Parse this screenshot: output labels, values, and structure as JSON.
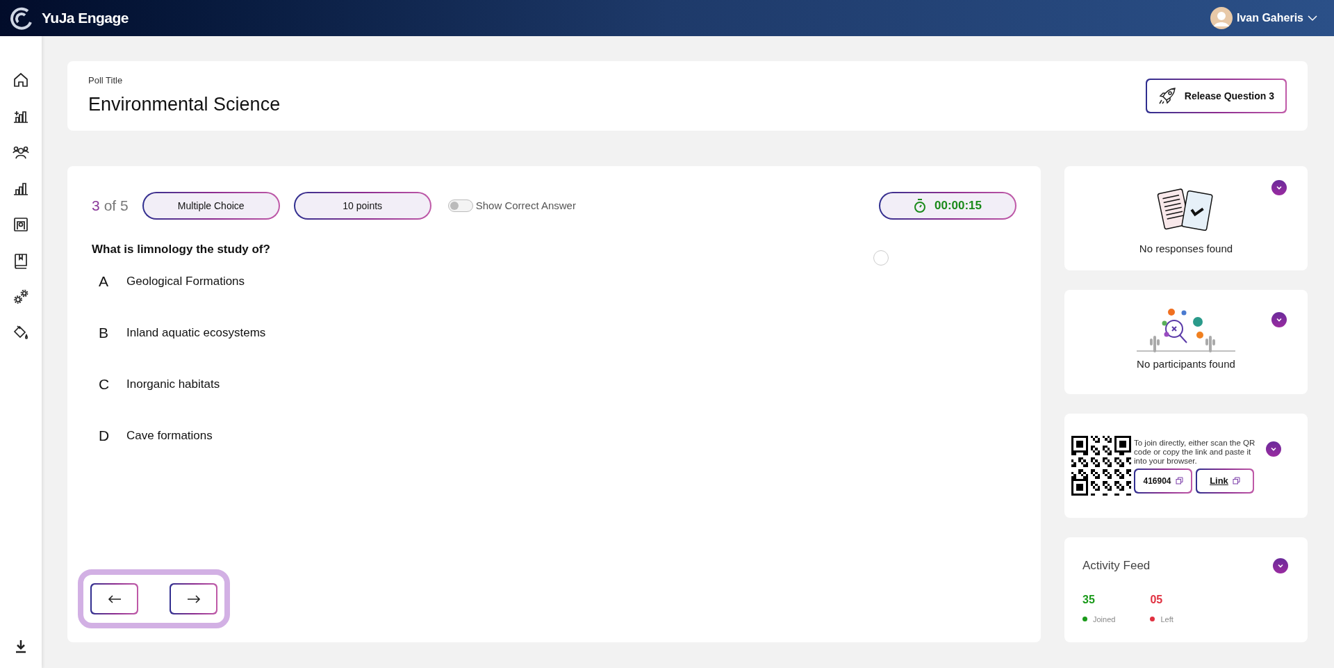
{
  "header": {
    "brand": "YuJa Engage",
    "user": "Ivan Gaheris"
  },
  "poll": {
    "label": "Poll Title",
    "title": "Environmental Science",
    "release_button": "Release Question 3"
  },
  "question": {
    "number": "3",
    "of_total": "of 5",
    "type": "Multiple Choice",
    "points": "10 points",
    "show_correct_answer": {
      "label": "Show Correct Answer",
      "on": false
    },
    "timer": "00:00:15",
    "text": "What is limnology the study of?",
    "options": [
      {
        "letter": "A",
        "text": "Geological Formations"
      },
      {
        "letter": "B",
        "text": "Inland aquatic ecosystems"
      },
      {
        "letter": "C",
        "text": "Inorganic habitats"
      },
      {
        "letter": "D",
        "text": "Cave formations"
      }
    ]
  },
  "responses": {
    "message": "No responses found"
  },
  "participants": {
    "message": "No participants found"
  },
  "join": {
    "instructions": "To join directly, either scan the QR code or copy the link and paste it into your browser.",
    "code": "416904",
    "link": "Link"
  },
  "activity": {
    "title": "Activity Feed",
    "stats": [
      {
        "value": "35",
        "label": "Joined",
        "color": "#1a9a1a"
      },
      {
        "value": "05",
        "label": "Left",
        "color": "#e03040"
      }
    ]
  }
}
